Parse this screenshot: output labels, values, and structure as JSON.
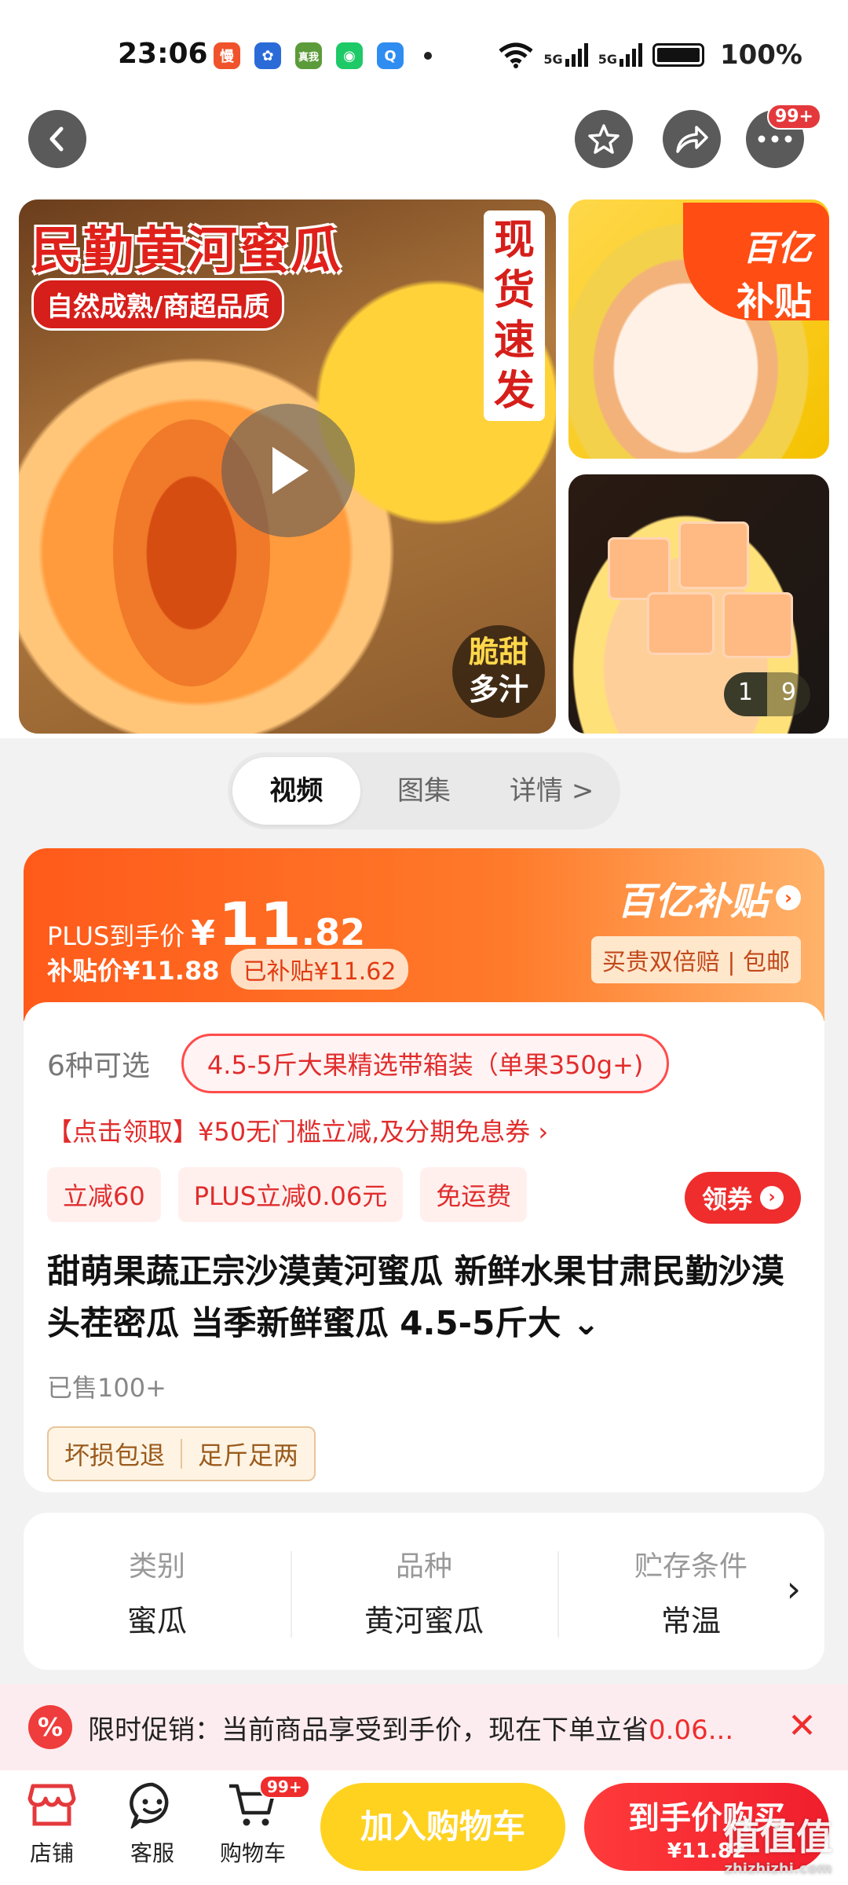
{
  "status_bar": {
    "time": "23:06",
    "apps": [
      {
        "icon": "慢",
        "color": "#f0532b"
      },
      {
        "icon": "✿",
        "color": "#2b6bd8"
      },
      {
        "icon": "真我",
        "color": "#5c9b3a"
      },
      {
        "icon": "◉",
        "color": "#1ec968"
      },
      {
        "icon": "Q",
        "color": "#2f8cf0"
      }
    ],
    "net1": "5G",
    "net2": "5G",
    "battery": "100%"
  },
  "nav": {
    "badge": "99+"
  },
  "gallery": {
    "main_title": "民勤黄河蜜瓜",
    "main_subtitle": "自然成熟/商超品质",
    "vertical_tag": [
      "现",
      "货",
      "速",
      "发"
    ],
    "crisp_line1": "脆甜",
    "crisp_line2": "多汁",
    "subsidy_badge_1": "百亿",
    "subsidy_badge_2": "补贴",
    "counter_current": "1",
    "counter_total": "9"
  },
  "media_tabs": [
    "视频",
    "图集",
    "详情 >"
  ],
  "price": {
    "plus_label": "PLUS到手价",
    "currency": "¥",
    "int": "11",
    "dec": ".82",
    "subsidy_price": "补贴价¥11.88",
    "subsidized": "已补贴¥11.62",
    "brand": "百亿补贴",
    "guarantee": "买贵双倍赔 | 包邮"
  },
  "spec": {
    "count": "6种可选",
    "selected": "4.5-5斤大果精选带箱装（单果350g+)"
  },
  "coupon_line": "【点击领取】¥50无门槛立减,及分期免息券 ›",
  "tags": [
    "立减60",
    "PLUS立减0.06元",
    "免运费"
  ],
  "get_coupon": "领券",
  "product_title": "甜萌果蔬正宗沙漠黄河蜜瓜 新鲜水果甘肃民勤沙漠头茬密瓜 当季新鲜蜜瓜 4.5-5斤大 ⌄",
  "sold": "已售100+",
  "guarantees": [
    "坏损包退",
    "足斤足两"
  ],
  "attributes": [
    {
      "key": "类别",
      "value": "蜜瓜"
    },
    {
      "key": "品种",
      "value": "黄河蜜瓜"
    },
    {
      "key": "贮存条件",
      "value": "常温"
    }
  ],
  "promo": {
    "text": "限时促销：当前商品享受到手价，现在下单立省",
    "highlight": "0.06..."
  },
  "bottom": {
    "store": "店铺",
    "service": "客服",
    "cart": "购物车",
    "cart_badge": "99+",
    "add_cart": "加入购物车",
    "buy": "到手价购买",
    "buy_price": "¥11.82",
    "watermark": "值值值",
    "watermark_sub": "zhizhizhi.com"
  }
}
